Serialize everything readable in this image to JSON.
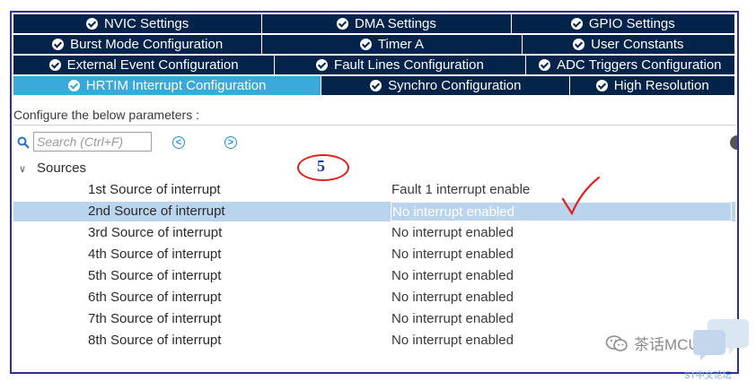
{
  "tab_rows": [
    [
      {
        "label": "NVIC Settings",
        "active": false
      },
      {
        "label": "DMA Settings",
        "active": false
      },
      {
        "label": "GPIO Settings",
        "active": false
      }
    ],
    [
      {
        "label": "Burst Mode Configuration",
        "active": false
      },
      {
        "label": "Timer A",
        "active": false
      },
      {
        "label": "User Constants",
        "active": false
      }
    ],
    [
      {
        "label": "External Event Configuration",
        "active": false
      },
      {
        "label": "Fault Lines Configuration",
        "active": false
      },
      {
        "label": "ADC Triggers Configuration",
        "active": false
      }
    ],
    [
      {
        "label": "HRTIM Interrupt Configuration",
        "active": true
      },
      {
        "label": "Synchro Configuration",
        "active": false
      },
      {
        "label": "High Resolution",
        "active": false
      }
    ]
  ],
  "colors": {
    "tab_bg": "#03234b",
    "tab_active": "#39a9dc",
    "selected_row": "#b9d4ec",
    "annotation_red": "#e02020"
  },
  "config_label": "Configure the below parameters :",
  "search": {
    "placeholder": "Search (Ctrl+F)",
    "value": ""
  },
  "nav": {
    "prev_icon": "arrow-left-circle-icon",
    "next_icon": "arrow-right-circle-icon",
    "prev_glyph": "<",
    "next_glyph": ">"
  },
  "tree": {
    "toggle_glyph": "∨",
    "group_label": "Sources"
  },
  "parameters": [
    {
      "name": "1st Source of interrupt",
      "value": "Fault 1 interrupt enable",
      "selected": false
    },
    {
      "name": "2nd Source of interrupt",
      "value": "No interrupt enabled",
      "selected": true
    },
    {
      "name": "3rd Source of interrupt",
      "value": "No interrupt enabled",
      "selected": false
    },
    {
      "name": "4th Source of interrupt",
      "value": "No interrupt enabled",
      "selected": false
    },
    {
      "name": "5th Source of interrupt",
      "value": "No interrupt enabled",
      "selected": false
    },
    {
      "name": "6th Source of interrupt",
      "value": "No interrupt enabled",
      "selected": false
    },
    {
      "name": "7th Source of interrupt",
      "value": "No interrupt enabled",
      "selected": false
    },
    {
      "name": "8th Source of interrupt",
      "value": "No interrupt enabled",
      "selected": false
    }
  ],
  "annotation": {
    "number": "5"
  },
  "watermark": {
    "text": "茶话MCU",
    "forum": "ST中文论坛"
  }
}
